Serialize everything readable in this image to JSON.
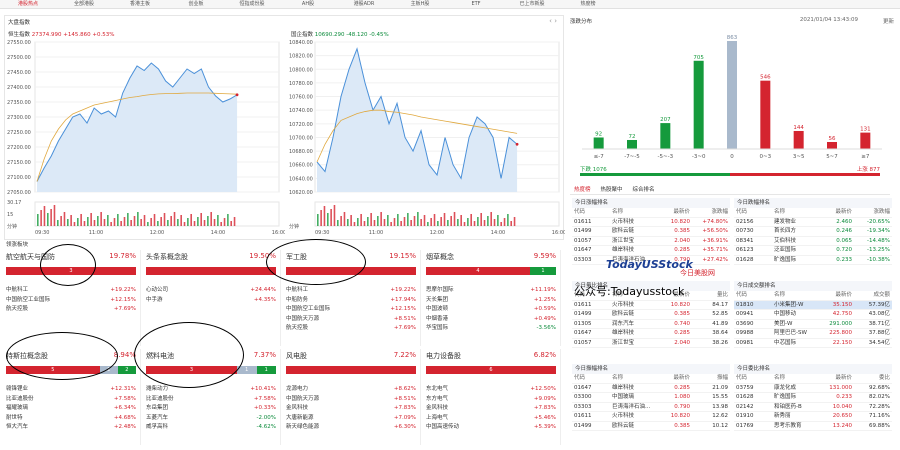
{
  "nav": {
    "tabs": [
      "港股热点",
      "全部港股",
      "香港主板",
      "创业板",
      "恒指成份股",
      "AH股",
      "港股ADR",
      "主板H股",
      "ETF",
      "已上市新股",
      "热度榜"
    ]
  },
  "index_panel": {
    "title": "大盘指数",
    "hsi": {
      "name": "恒生指数",
      "value": "27374.990",
      "change": "+145.860",
      "pct": "+0.53%",
      "yticks": [
        "27550.00",
        "27500.00",
        "27450.00",
        "27400.00",
        "27350.00",
        "27300.00",
        "27250.00",
        "27200.00",
        "27150.00",
        "27100.00",
        "27050.00"
      ],
      "vol_ticks": [
        "30.17",
        "15",
        "分钟"
      ],
      "line": [
        27085,
        27130,
        27170,
        27220,
        27260,
        27300,
        27310,
        27280,
        27330,
        27310,
        27320,
        27300,
        27380,
        27430,
        27470,
        27455,
        27480,
        27460,
        27420,
        27400,
        27430,
        27460,
        27445,
        27460,
        27400,
        27370,
        27350,
        27360,
        27374
      ],
      "avg": [
        27085,
        27160,
        27220,
        27260,
        27290,
        27310,
        27320,
        27330,
        27340,
        27345,
        27350,
        27355,
        27360,
        27365,
        27368,
        27372,
        27375,
        27377,
        27378,
        27378,
        27379,
        27380,
        27380,
        27380,
        27380,
        27379,
        27378,
        27377,
        27376
      ]
    },
    "hscei": {
      "name": "国企指数",
      "value": "10690.290",
      "change": "-48.120",
      "pct": "-0.45%",
      "yticks": [
        "10840.00",
        "10820.00",
        "10800.00",
        "10780.00",
        "10760.00",
        "10740.00",
        "10720.00",
        "10700.00",
        "10680.00",
        "10660.00",
        "10640.00",
        "10620.00"
      ],
      "vol_ticks": [
        "分钟"
      ],
      "line": [
        10664,
        10650,
        10700,
        10760,
        10800,
        10830,
        10780,
        10740,
        10760,
        10720,
        10750,
        10700,
        10680,
        10710,
        10660,
        10645,
        10700,
        10660,
        10640,
        10700,
        10730,
        10720,
        10700,
        10640,
        10700,
        10690
      ],
      "avg": [
        10664,
        10690,
        10710,
        10725,
        10730,
        10735,
        10738,
        10740,
        10740,
        10738,
        10737,
        10735,
        10733,
        10730,
        10728,
        10726,
        10724,
        10722,
        10720,
        10718,
        10716,
        10714,
        10712,
        10710,
        10708,
        10706
      ]
    },
    "x_ticks": [
      "09:30",
      "11:00",
      "12:00",
      "14:00",
      "16:00"
    ]
  },
  "distribution": {
    "title": "涨跌分布",
    "datetime": "2021/01/04 13:43:09",
    "more": "更新",
    "down_label": "下跌",
    "down_count": "1076",
    "up_label": "上涨",
    "up_count": "877"
  },
  "chart_data": {
    "type": "bar",
    "categories": [
      "≤-7",
      "-7~-5",
      "-5~-3",
      "-3~0",
      "0",
      "0~3",
      "3~5",
      "5~7",
      "≥7"
    ],
    "values": [
      92,
      72,
      207,
      705,
      863,
      546,
      144,
      56,
      131
    ],
    "colors": [
      "#159a3c",
      "#159a3c",
      "#159a3c",
      "#159a3c",
      "#a9b9cc",
      "#d4242f",
      "#d4242f",
      "#d4242f",
      "#d4242f"
    ],
    "ylim": [
      0,
      863
    ]
  },
  "sectors_title": "领涨板块",
  "sectors": [
    {
      "name": "航空航天与国防",
      "pct": "19.78%",
      "bar": [
        {
          "v": "3",
          "c": "#d4242f",
          "w": 100
        }
      ],
      "stocks": [
        [
          "中航科工",
          "+19.22%"
        ],
        [
          "中国航空工业国际",
          "+12.15%"
        ],
        [
          "航天控股",
          "+7.69%"
        ]
      ]
    },
    {
      "name": "头条系概念股",
      "pct": "19.50%",
      "bar": [
        {
          "v": "",
          "c": "#d4242f",
          "w": 100
        }
      ],
      "stocks": [
        [
          "心动公司",
          "+24.44%"
        ],
        [
          "中手游",
          "+4.35%"
        ]
      ]
    },
    {
      "name": "军工股",
      "pct": "19.15%",
      "bar": [
        {
          "v": "",
          "c": "#d4242f",
          "w": 100
        }
      ],
      "stocks": [
        [
          "中航科工",
          "+19.22%"
        ],
        [
          "中船防务",
          "+17.94%"
        ],
        [
          "中国航空工业国际",
          "+12.15%"
        ],
        [
          "中国航天万源",
          "+8.51%"
        ],
        [
          "航天控股",
          "+7.69%"
        ]
      ]
    },
    {
      "name": "烟草概念",
      "pct": "9.59%",
      "bar": [
        {
          "v": "4",
          "c": "#d4242f",
          "w": 80
        },
        {
          "v": "1",
          "c": "#159a3c",
          "w": 20
        }
      ],
      "stocks": [
        [
          "思摩尔国际",
          "+11.19%"
        ],
        [
          "天长集团",
          "+1.25%"
        ],
        [
          "中国波顿",
          "+0.59%"
        ],
        [
          "中烟香港",
          "+0.49%"
        ],
        [
          "华宝国际",
          "-3.56%"
        ]
      ]
    },
    {
      "name": "特斯拉概念股",
      "pct": "8.94%",
      "bar": [
        {
          "v": "5",
          "c": "#d4242f",
          "w": 72
        },
        {
          "v": "1",
          "c": "#a9b9cc",
          "w": 14
        },
        {
          "v": "2",
          "c": "#159a3c",
          "w": 14
        }
      ],
      "stocks": [
        [
          "赣锋锂业",
          "+12.31%"
        ],
        [
          "比亚迪股份",
          "+7.58%"
        ],
        [
          "福耀玻璃",
          "+6.34%"
        ],
        [
          "耐世特",
          "+4.68%"
        ],
        [
          "恒大汽车",
          "+2.48%"
        ]
      ]
    },
    {
      "name": "燃料电池",
      "pct": "7.37%",
      "bar": [
        {
          "v": "3",
          "c": "#d4242f",
          "w": 70
        },
        {
          "v": "1",
          "c": "#a9b9cc",
          "w": 15
        },
        {
          "v": "1",
          "c": "#159a3c",
          "w": 15
        }
      ],
      "stocks": [
        [
          "潍柴动力",
          "+10.41%"
        ],
        [
          "比亚迪股份",
          "+7.58%"
        ],
        [
          "东岳集团",
          "+0.33%"
        ],
        [
          "五菱汽车",
          "-2.00%"
        ],
        [
          "威孚高科",
          "-4.62%"
        ]
      ]
    },
    {
      "name": "风电股",
      "pct": "7.22%",
      "bar": [
        {
          "v": "",
          "c": "#d4242f",
          "w": 100
        }
      ],
      "stocks": [
        [
          "龙源电力",
          "+8.62%"
        ],
        [
          "中国航天万源",
          "+8.51%"
        ],
        [
          "金风科技",
          "+7.83%"
        ],
        [
          "大唐新能源",
          "+7.09%"
        ],
        [
          "新天绿色能源",
          "+6.30%"
        ]
      ]
    },
    {
      "name": "电力设备股",
      "pct": "6.82%",
      "bar": [
        {
          "v": "6",
          "c": "#d4242f",
          "w": 100
        }
      ],
      "stocks": [
        [
          "东北电气",
          "+12.50%"
        ],
        [
          "东方电气",
          "+9.09%"
        ],
        [
          "金风科技",
          "+7.83%"
        ],
        [
          "上海电气",
          "+5.46%"
        ],
        [
          "中国高速传动",
          "+5.39%"
        ]
      ]
    }
  ],
  "hot": {
    "tabs": [
      "热度榜",
      "热股聚中",
      "综合排名"
    ],
    "tables": [
      {
        "title": "今日涨幅排名",
        "cols": [
          "代码",
          "名称",
          "最新价",
          "涨跌幅"
        ],
        "rows": [
          [
            "01611",
            "火币科技",
            "10.820",
            "+74.80%"
          ],
          [
            "01499",
            "欧科云链",
            "0.385",
            "+56.50%"
          ],
          [
            "01057",
            "浙江世宝",
            "2.040",
            "+36.91%"
          ],
          [
            "01647",
            "雄岸科技",
            "0.285",
            "+35.71%"
          ],
          [
            "03303",
            "巨涛海洋石油...",
            "0.790",
            "+27.42%"
          ]
        ]
      },
      {
        "title": "今日跌幅排名",
        "cols": [
          "代码",
          "名称",
          "最新价",
          "涨跌幅"
        ],
        "rows": [
          [
            "02156",
            "建发物业",
            "2.460",
            "-20.65%"
          ],
          [
            "00730",
            "首长四方",
            "0.246",
            "-19.34%"
          ],
          [
            "08341",
            "艾伯科技",
            "0.065",
            "-14.48%"
          ],
          [
            "06123",
            "泛亚国际",
            "0.720",
            "-13.25%"
          ],
          [
            "01628",
            "旷逸国际",
            "0.233",
            "-10.38%"
          ]
        ]
      },
      {
        "title": "今日量比排名",
        "cols": [
          "代码",
          "名称",
          "最新价",
          "量比"
        ],
        "rows": [
          [
            "01611",
            "火币科技",
            "10.820",
            "84.17"
          ],
          [
            "01499",
            "欧科云链",
            "0.385",
            "52.85"
          ],
          [
            "01305",
            "润东汽车",
            "0.740",
            "41.89"
          ],
          [
            "01647",
            "雄岸科技",
            "0.285",
            "38.64"
          ],
          [
            "01057",
            "浙江世宝",
            "2.040",
            "38.26"
          ]
        ]
      },
      {
        "title": "今日成交额排名",
        "cols": [
          "代码",
          "名称",
          "最新价",
          "成交额"
        ],
        "rows": [
          [
            "01810",
            "小米集团-W",
            "35.150",
            "57.39亿"
          ],
          [
            "00941",
            "中国移动",
            "42.750",
            "43.08亿"
          ],
          [
            "03690",
            "美团-W",
            "291.000",
            "38.71亿"
          ],
          [
            "09988",
            "阿里巴巴-SW",
            "225.800",
            "37.88亿"
          ],
          [
            "00981",
            "中芯国际",
            "22.150",
            "34.54亿"
          ]
        ]
      },
      {
        "title": "今日振幅排名",
        "cols": [
          "代码",
          "名称",
          "最新价",
          "振幅"
        ],
        "rows": [
          [
            "01647",
            "雄岸科技",
            "0.285",
            "21.09"
          ],
          [
            "03300",
            "中国玻璃",
            "1.080",
            "15.55"
          ],
          [
            "03303",
            "巨涛海洋石油...",
            "0.790",
            "13.98"
          ],
          [
            "01611",
            "火币科技",
            "10.820",
            "12.62"
          ],
          [
            "01499",
            "欧科云链",
            "0.385",
            "10.12"
          ]
        ]
      },
      {
        "title": "今日委比排名",
        "cols": [
          "代码",
          "名称",
          "最新价",
          "委比"
        ],
        "rows": [
          [
            "03759",
            "康龙化成",
            "131.000",
            "92.68%"
          ],
          [
            "01628",
            "旷逸国际",
            "0.233",
            "82.02%"
          ],
          [
            "02142",
            "和铂医药-B",
            "10.040",
            "72.28%"
          ],
          [
            "01910",
            "新秀丽",
            "20.650",
            "71.16%"
          ],
          [
            "01769",
            "思考乐教育",
            "13.240",
            "69.88%"
          ]
        ]
      }
    ]
  },
  "watermark": {
    "logo": "TodayUSStock",
    "logo_sub": "今日美股网",
    "caption": "公众号:Todayusstock"
  }
}
